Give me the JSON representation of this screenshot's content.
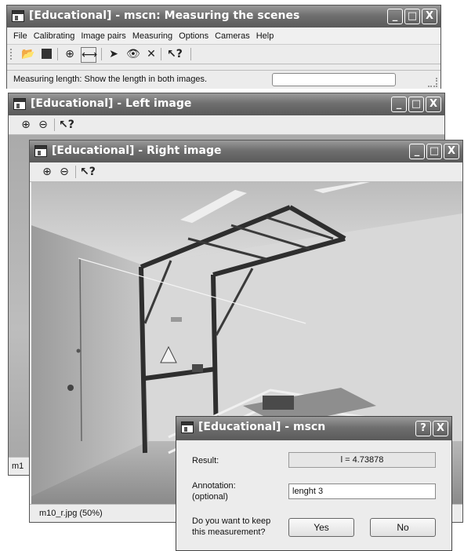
{
  "main_window": {
    "title": "[Educational] - mscn: Measuring the scenes",
    "menu": [
      "File",
      "Calibrating",
      "Image pairs",
      "Measuring",
      "Options",
      "Cameras",
      "Help"
    ],
    "status_text": "Measuring length: Show the length in both images."
  },
  "left_window": {
    "title": "[Educational] - Left image",
    "status_text": "m1"
  },
  "right_window": {
    "title": "[Educational] - Right image",
    "status_text": "m10_r.jpg (50%)"
  },
  "dialog": {
    "title": "[Educational] - mscn",
    "result_label": "Result:",
    "result_value": "l = 4.73878",
    "annotation_label_line1": "Annotation:",
    "annotation_label_line2": "(optional)",
    "annotation_value": "lenght 3",
    "keep_question_line1": "Do you want to keep",
    "keep_question_line2": "this measurement?",
    "yes_label": "Yes",
    "no_label": "No"
  },
  "window_buttons": {
    "minimize": "_",
    "maximize": "□",
    "close": "X",
    "help": "?"
  },
  "icons": [
    "open-folder-icon",
    "stop-icon",
    "crosshair-icon",
    "measure-length-icon",
    "pointer-icon",
    "eye-icon",
    "delete-icon",
    "help-pointer-icon",
    "zoom-in-icon",
    "zoom-out-icon"
  ]
}
